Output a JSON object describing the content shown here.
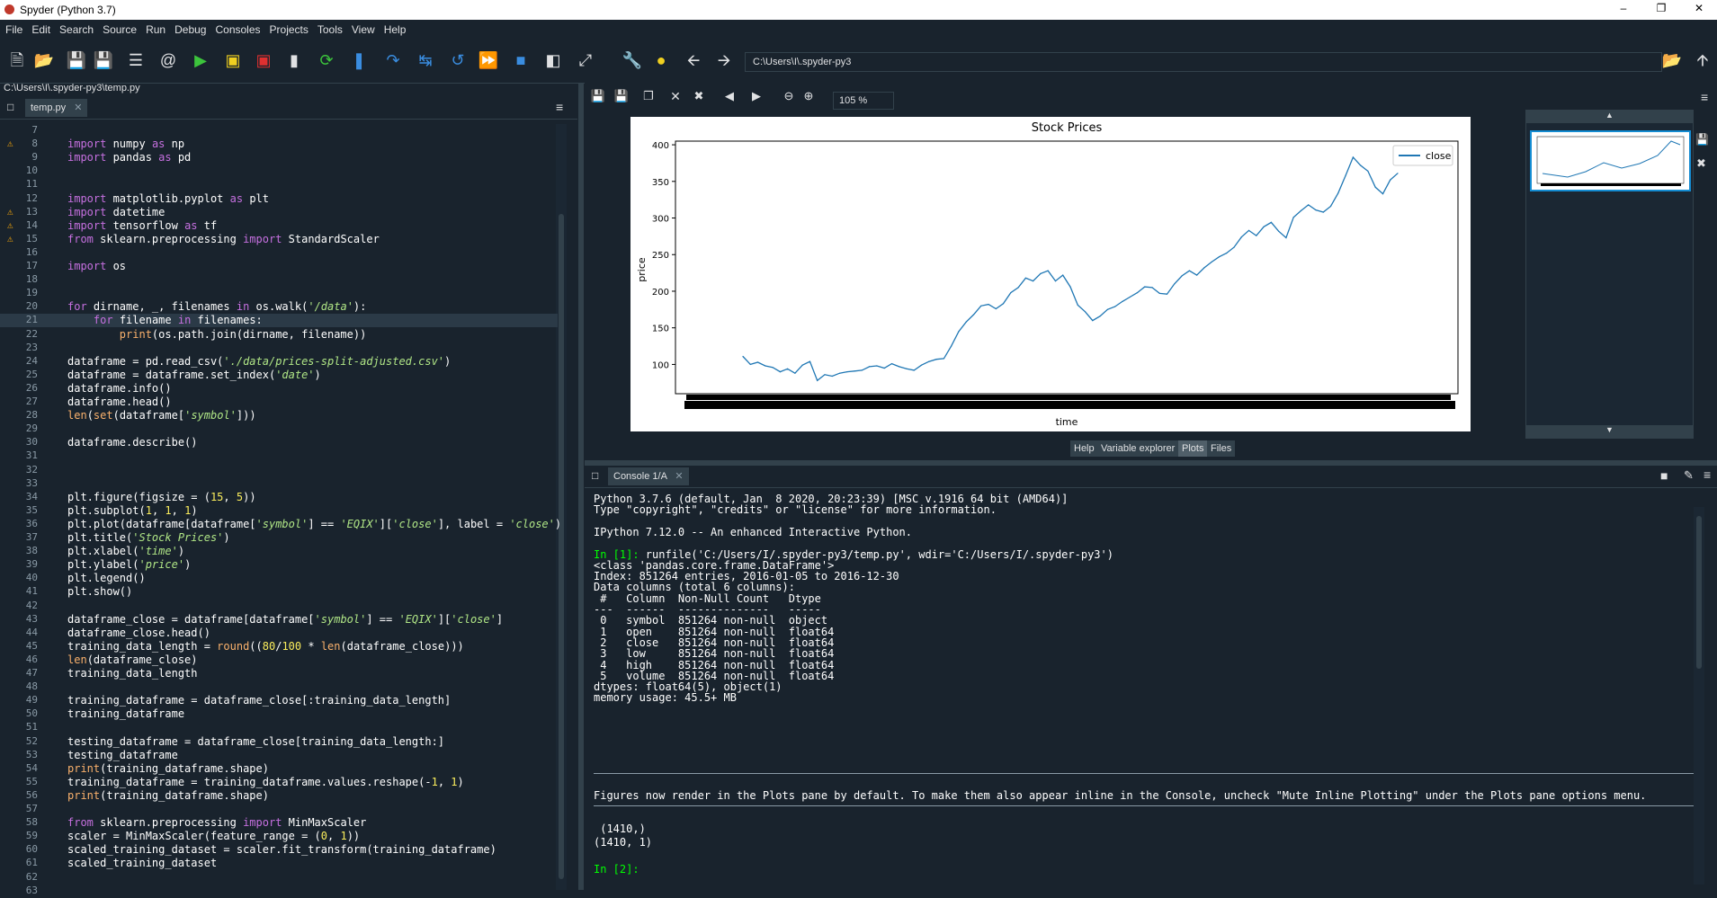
{
  "window": {
    "title": "Spyder (Python 3.7)",
    "min": "–",
    "restore": "❐",
    "close": "✕"
  },
  "menu": [
    "File",
    "Edit",
    "Search",
    "Source",
    "Run",
    "Debug",
    "Consoles",
    "Projects",
    "Tools",
    "View",
    "Help"
  ],
  "toolbar": {
    "path": "C:\\Users\\I\\.spyder-py3"
  },
  "editor": {
    "file_path": "C:\\Users\\I\\.spyder-py3\\temp.py",
    "tab_label": "temp.py",
    "tab_close": "✕",
    "menu_icon": "≡",
    "lines": [
      {
        "n": "7",
        "t": "",
        "w": false
      },
      {
        "n": "8",
        "t": "import numpy as np",
        "w": true
      },
      {
        "n": "9",
        "t": "import pandas as pd",
        "w": false
      },
      {
        "n": "10",
        "t": "",
        "w": false
      },
      {
        "n": "11",
        "t": "",
        "w": false
      },
      {
        "n": "12",
        "t": "import matplotlib.pyplot as plt",
        "w": false
      },
      {
        "n": "13",
        "t": "import datetime",
        "w": true
      },
      {
        "n": "14",
        "t": "import tensorflow as tf",
        "w": true
      },
      {
        "n": "15",
        "t": "from sklearn.preprocessing import StandardScaler",
        "w": true
      },
      {
        "n": "16",
        "t": "",
        "w": false
      },
      {
        "n": "17",
        "t": "import os",
        "w": false
      },
      {
        "n": "18",
        "t": "",
        "w": false
      },
      {
        "n": "19",
        "t": "",
        "w": false
      },
      {
        "n": "20",
        "t": "for dirname, _, filenames in os.walk('/data'):",
        "w": false
      },
      {
        "n": "21",
        "t": "    for filename in filenames:",
        "w": false,
        "hl": true
      },
      {
        "n": "22",
        "t": "        print(os.path.join(dirname, filename))",
        "w": false
      },
      {
        "n": "23",
        "t": "",
        "w": false
      },
      {
        "n": "24",
        "t": "dataframe = pd.read_csv('./data/prices-split-adjusted.csv')",
        "w": false
      },
      {
        "n": "25",
        "t": "dataframe = dataframe.set_index('date')",
        "w": false
      },
      {
        "n": "26",
        "t": "dataframe.info()",
        "w": false
      },
      {
        "n": "27",
        "t": "dataframe.head()",
        "w": false
      },
      {
        "n": "28",
        "t": "len(set(dataframe['symbol']))",
        "w": false
      },
      {
        "n": "29",
        "t": "",
        "w": false
      },
      {
        "n": "30",
        "t": "dataframe.describe()",
        "w": false
      },
      {
        "n": "31",
        "t": "",
        "w": false
      },
      {
        "n": "32",
        "t": "",
        "w": false
      },
      {
        "n": "33",
        "t": "",
        "w": false
      },
      {
        "n": "34",
        "t": "plt.figure(figsize = (15, 5))",
        "w": false
      },
      {
        "n": "35",
        "t": "plt.subplot(1, 1, 1)",
        "w": false
      },
      {
        "n": "36",
        "t": "plt.plot(dataframe[dataframe['symbol'] == 'EQIX']['close'], label = 'close')",
        "w": false
      },
      {
        "n": "37",
        "t": "plt.title('Stock Prices')",
        "w": false
      },
      {
        "n": "38",
        "t": "plt.xlabel('time')",
        "w": false
      },
      {
        "n": "39",
        "t": "plt.ylabel('price')",
        "w": false
      },
      {
        "n": "40",
        "t": "plt.legend()",
        "w": false
      },
      {
        "n": "41",
        "t": "plt.show()",
        "w": false
      },
      {
        "n": "42",
        "t": "",
        "w": false
      },
      {
        "n": "43",
        "t": "dataframe_close = dataframe[dataframe['symbol'] == 'EQIX']['close']",
        "w": false
      },
      {
        "n": "44",
        "t": "dataframe_close.head()",
        "w": false
      },
      {
        "n": "45",
        "t": "training_data_length = round((80/100 * len(dataframe_close)))",
        "w": false
      },
      {
        "n": "46",
        "t": "len(dataframe_close)",
        "w": false
      },
      {
        "n": "47",
        "t": "training_data_length",
        "w": false
      },
      {
        "n": "48",
        "t": "",
        "w": false
      },
      {
        "n": "49",
        "t": "training_dataframe = dataframe_close[:training_data_length]",
        "w": false
      },
      {
        "n": "50",
        "t": "training_dataframe",
        "w": false
      },
      {
        "n": "51",
        "t": "",
        "w": false
      },
      {
        "n": "52",
        "t": "testing_dataframe = dataframe_close[training_data_length:]",
        "w": false
      },
      {
        "n": "53",
        "t": "testing_dataframe",
        "w": false
      },
      {
        "n": "54",
        "t": "print(training_dataframe.shape)",
        "w": false
      },
      {
        "n": "55",
        "t": "training_dataframe = training_dataframe.values.reshape(-1, 1)",
        "w": false
      },
      {
        "n": "56",
        "t": "print(training_dataframe.shape)",
        "w": false
      },
      {
        "n": "57",
        "t": "",
        "w": false
      },
      {
        "n": "58",
        "t": "from sklearn.preprocessing import MinMaxScaler",
        "w": false
      },
      {
        "n": "59",
        "t": "scaler = MinMaxScaler(feature_range = (0, 1))",
        "w": false
      },
      {
        "n": "60",
        "t": "scaled_training_dataset = scaler.fit_transform(training_dataframe)",
        "w": false
      },
      {
        "n": "61",
        "t": "scaled_training_dataset",
        "w": false
      },
      {
        "n": "62",
        "t": "",
        "w": false
      },
      {
        "n": "63",
        "t": "",
        "w": false
      }
    ]
  },
  "plots": {
    "zoom": "105 %",
    "tabs": [
      "Help",
      "Variable explorer",
      "Plots",
      "Files"
    ],
    "active_tab": "Plots"
  },
  "chart_data": {
    "type": "line",
    "title": "Stock Prices",
    "xlabel": "time",
    "ylabel": "price",
    "ylim": [
      60,
      405
    ],
    "yticks": [
      100,
      150,
      200,
      250,
      300,
      350,
      400
    ],
    "legend": "top-right",
    "series": [
      {
        "name": "close",
        "color": "#1f77b4",
        "x_index": [
          0,
          20,
          40,
          60,
          80,
          100,
          120,
          140,
          160,
          180,
          200,
          220,
          240,
          260,
          280,
          300,
          320,
          340,
          360,
          380,
          400,
          420,
          440,
          460,
          480,
          500,
          520,
          540,
          560,
          580,
          600,
          620,
          640,
          660,
          680,
          700,
          720,
          740,
          760,
          780,
          800,
          820,
          840,
          860,
          880,
          900,
          920,
          940,
          960,
          980,
          1000,
          1020,
          1040,
          1060,
          1080,
          1100,
          1120,
          1140,
          1160,
          1180,
          1200,
          1220,
          1240,
          1260,
          1280,
          1300,
          1320,
          1340,
          1360,
          1380,
          1400,
          1420,
          1440,
          1460,
          1480,
          1500,
          1520,
          1540,
          1560,
          1580,
          1600,
          1620,
          1640,
          1660,
          1680,
          1700,
          1720,
          1740,
          1760
        ],
        "values": [
          111,
          100,
          103,
          98,
          96,
          90,
          94,
          88,
          99,
          104,
          78,
          86,
          84,
          88,
          90,
          91,
          92,
          97,
          98,
          95,
          101,
          97,
          94,
          92,
          99,
          104,
          107,
          108,
          125,
          145,
          158,
          168,
          180,
          182,
          176,
          183,
          198,
          205,
          218,
          214,
          224,
          228,
          214,
          222,
          206,
          181,
          172,
          160,
          166,
          175,
          179,
          186,
          192,
          198,
          206,
          205,
          197,
          196,
          210,
          221,
          228,
          222,
          232,
          240,
          247,
          252,
          260,
          274,
          283,
          276,
          288,
          294,
          282,
          273,
          301,
          310,
          318,
          311,
          308,
          316,
          334,
          358,
          383,
          372,
          364,
          342,
          333,
          352,
          361
        ]
      }
    ]
  },
  "console": {
    "tab_label": "Console 1/A",
    "tab_close": "✕",
    "lines": [
      "Python 3.7.6 (default, Jan  8 2020, 20:23:39) [MSC v.1916 64 bit (AMD64)]",
      "Type \"copyright\", \"credits\" or \"license\" for more information.",
      "",
      "IPython 7.12.0 -- An enhanced Interactive Python.",
      "",
      "In [1]: runfile('C:/Users/I/.spyder-py3/temp.py', wdir='C:/Users/I/.spyder-py3')",
      "<class 'pandas.core.frame.DataFrame'>",
      "Index: 851264 entries, 2016-01-05 to 2016-12-30",
      "Data columns (total 6 columns):",
      " #   Column  Non-Null Count   Dtype  ",
      "---  ------  --------------   -----  ",
      " 0   symbol  851264 non-null  object ",
      " 1   open    851264 non-null  float64",
      " 2   close   851264 non-null  float64",
      " 3   low     851264 non-null  float64",
      " 4   high    851264 non-null  float64",
      " 5   volume  851264 non-null  float64",
      "dtypes: float64(5), object(1)",
      "memory usage: 45.5+ MB"
    ],
    "notice": "Figures now render in the Plots pane by default. To make them also appear inline in the Console, uncheck \"Mute Inline Plotting\" under the Plots pane options menu.",
    "out1": " (1410,)",
    "out2": "(1410, 1)",
    "prompt": "In [2]:"
  }
}
